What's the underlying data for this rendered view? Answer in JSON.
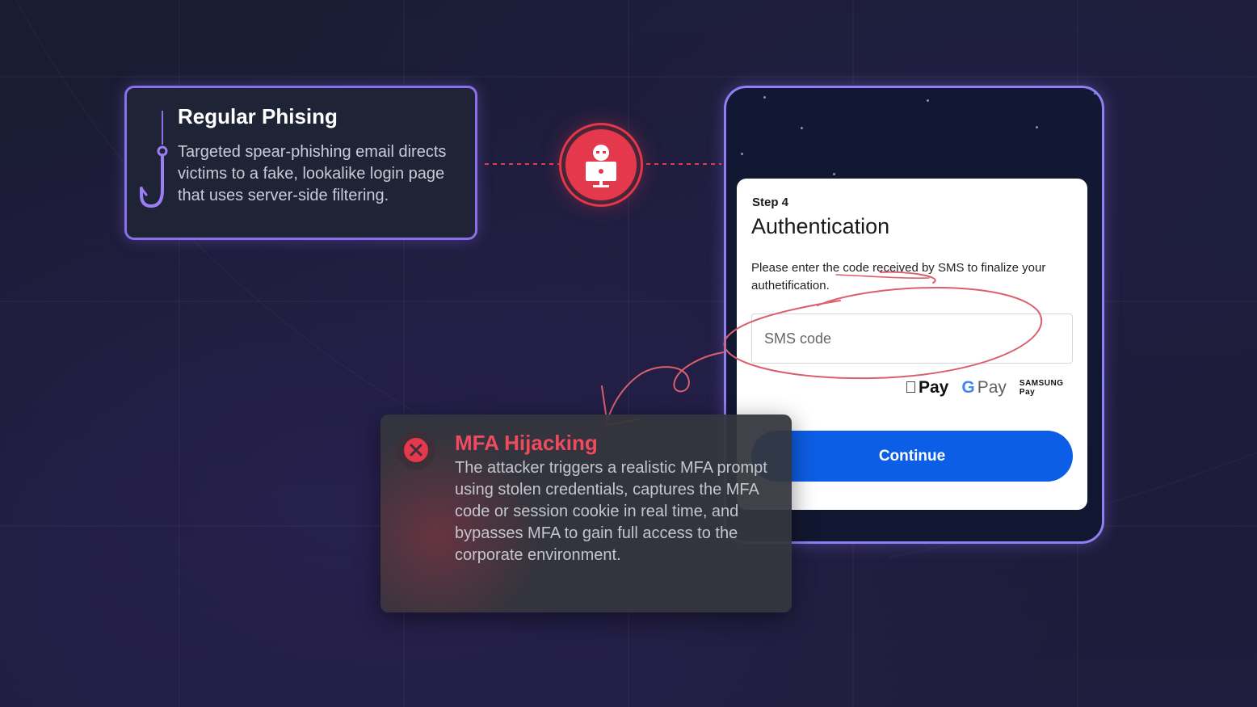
{
  "phishing_card": {
    "title": "Regular Phising",
    "description": "Targeted spear-phishing email directs victims to a fake, lookalike login page that uses server-side filtering.",
    "icon": "fish-hook-icon",
    "border_color": "#8b6ee8"
  },
  "attacker": {
    "icon": "hacker-icon",
    "color": "#e4384c"
  },
  "auth_form": {
    "step": "Step 4",
    "title": "Authentication",
    "description": "Please enter the code received by SMS to finalize your authetification.",
    "sms_placeholder": "SMS code",
    "payment_methods": {
      "apple_pay": "Pay",
      "google_pay": "Pay",
      "samsung_line1": "SAMSUNG",
      "samsung_line2": "Pay"
    },
    "continue_label": "Continue",
    "button_color": "#0d5ee6"
  },
  "mfa_card": {
    "title": "MFA Hijacking",
    "description": "The attacker triggers a realistic MFA prompt using stolen credentials, captures the MFA code or session cookie in real time, and bypasses MFA to gain full access to the corporate environment.",
    "icon": "error-x-icon",
    "accent_color": "#f04a5e"
  }
}
